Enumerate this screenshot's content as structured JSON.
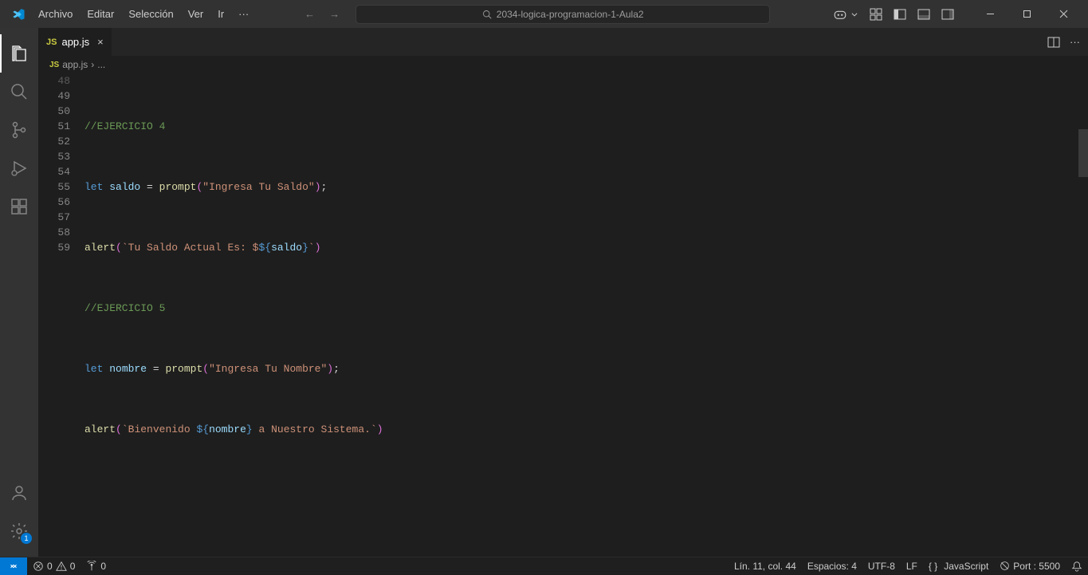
{
  "menu": {
    "items": [
      "Archivo",
      "Editar",
      "Selección",
      "Ver",
      "Ir"
    ],
    "more": "···"
  },
  "search": {
    "text": "2034-logica-programacion-1-Aula2"
  },
  "tab": {
    "filename": "app.js",
    "close": "×"
  },
  "breadcrumb": {
    "filename": "app.js",
    "sep": "›",
    "more": "..."
  },
  "gutter": [
    "48",
    "49",
    "50",
    "51",
    "52",
    "53",
    "54",
    "55",
    "56",
    "57",
    "58",
    "59"
  ],
  "code": {
    "l49": "//EJERCICIO 4",
    "l51": {
      "let": "let",
      "var": "saldo",
      "eq": " = ",
      "fn": "prompt",
      "lp": "(",
      "str": "\"Ingresa Tu Saldo\"",
      "rp": ")",
      "semi": ";"
    },
    "l53": {
      "fn": "alert",
      "lp": "(",
      "bt1": "`",
      "s1": "Tu Saldo Actual Es: $",
      "io": "${",
      "var": "saldo",
      "ic": "}",
      "bt2": "`",
      "rp": ")"
    },
    "l55": "//EJERCICIO 5",
    "l57": {
      "let": "let",
      "var": "nombre",
      "eq": " = ",
      "fn": "prompt",
      "lp": "(",
      "str": "\"Ingresa Tu Nombre\"",
      "rp": ")",
      "semi": ";"
    },
    "l59": {
      "fn": "alert",
      "lp": "(",
      "bt1": "`",
      "s1": "Bienvenido ",
      "io": "${",
      "var": "nombre",
      "ic": "}",
      "s2": " a Nuestro Sistema.",
      "bt2": "`",
      "rp": ")"
    }
  },
  "status": {
    "errors": "0",
    "warnings": "0",
    "ports": "0",
    "lncol": "Lín. 11, col. 44",
    "spaces": "Espacios: 4",
    "encoding": "UTF-8",
    "eol": "LF",
    "lang": "JavaScript",
    "port": "Port : 5500"
  },
  "activity_badge": "1"
}
